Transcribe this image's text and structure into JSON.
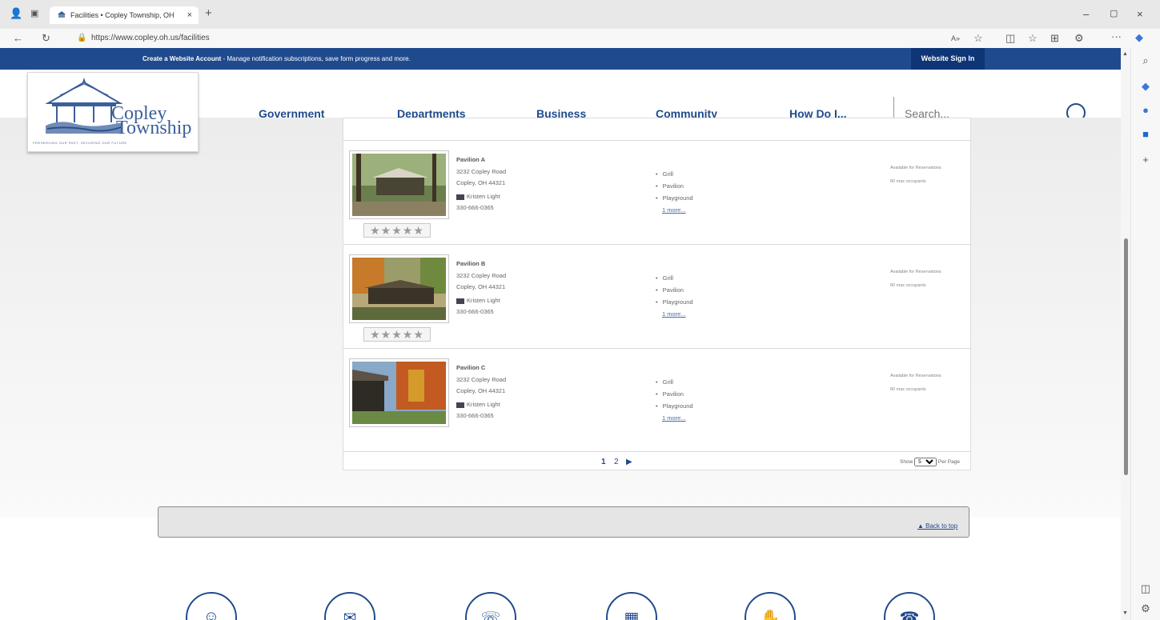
{
  "browser": {
    "tab_title": "Facilities • Copley Township, OH",
    "tab_close": "×",
    "new_tab": "+",
    "url": "https://www.copley.oh.us/facilities",
    "icons": [
      "profile-icon",
      "tab-actions-icon",
      "back-icon",
      "refresh-icon",
      "read-aloud-icon",
      "favorite-icon",
      "split-screen-icon",
      "favorites-icon",
      "collections-icon",
      "extensions-icon",
      "more-icon",
      "copilot-icon"
    ],
    "window_controls": [
      "–",
      "▢",
      "×"
    ]
  },
  "top_strip": {
    "bold_text": "Create a Website Account",
    "text": " - Manage notification subscriptions, save form progress and more.",
    "signin_label": "Website Sign In"
  },
  "logo": {
    "line1": "Copley",
    "line2": "Township",
    "tagline": "PRESERVING OUR PAST, SECURING OUR FUTURE"
  },
  "nav": {
    "items": [
      "Government",
      "Departments",
      "Business",
      "Community",
      "How Do I..."
    ],
    "search_placeholder": "Search..."
  },
  "facilities": [
    {
      "name": "Pavilion A",
      "address1": "3232 Copley Road",
      "address2": "Copley, OH 44321",
      "contact": "Kristen Light",
      "phone": "330-666-0365",
      "amenities": [
        "Grill",
        "Pavilion",
        "Playground"
      ],
      "more": "1 more...",
      "availability": "Available for Reservations",
      "occupancy": "80 max occupants",
      "rating": "★★★★★",
      "has_rating": true
    },
    {
      "name": "Pavilion B",
      "address1": "3232 Copley Road",
      "address2": "Copley, OH 44321",
      "contact": "Kristen Light",
      "phone": "330-666-0365",
      "amenities": [
        "Grill",
        "Pavilion",
        "Playground"
      ],
      "more": "1 more...",
      "availability": "Available for Reservations",
      "occupancy": "80 max occupants",
      "rating": "★★★★★",
      "has_rating": true
    },
    {
      "name": "Pavilion C",
      "address1": "3232 Copley Road",
      "address2": "Copley, OH 44321",
      "contact": "Kristen Light",
      "phone": "330-666-0365",
      "amenities": [
        "Grill",
        "Pavilion",
        "Playground"
      ],
      "more": "1 more...",
      "availability": "Available for Reservations",
      "occupancy": "80 max occupants",
      "has_rating": false
    }
  ],
  "pager": {
    "current": "1",
    "next_page": "2",
    "next_arrow": "▶",
    "show_label": "Show",
    "per_page_value": "5",
    "per_page_label": "Per Page"
  },
  "back_to_top": "▲ Back to top",
  "colors": {
    "brand_blue": "#1f4a8d",
    "signin_bg": "#0e3575"
  }
}
